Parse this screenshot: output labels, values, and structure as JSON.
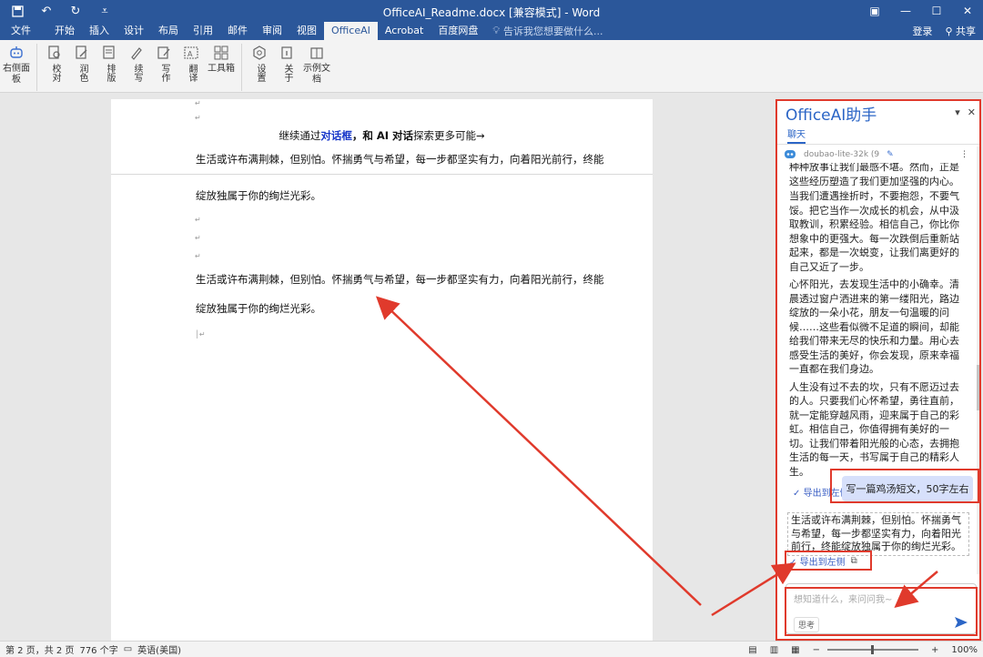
{
  "titlebar": {
    "title": "OfficeAI_Readme.docx [兼容模式] - Word"
  },
  "menu": {
    "tabs": [
      "文件",
      "开始",
      "插入",
      "设计",
      "布局",
      "引用",
      "邮件",
      "审阅",
      "视图",
      "OfficeAI",
      "Acrobat",
      "百度网盘"
    ],
    "active": "OfficeAI",
    "tell_me": "告诉我您想要做什么...",
    "login": "登录",
    "share": "共享"
  },
  "ribbon": {
    "buttons": [
      {
        "label": "右侧面板"
      },
      {
        "label": "校对"
      },
      {
        "label": "润色"
      },
      {
        "label": "排版"
      },
      {
        "label": "续写"
      },
      {
        "label": "写作"
      },
      {
        "label": "翻译"
      },
      {
        "label": "工具箱"
      },
      {
        "label": "设置"
      },
      {
        "label": "关于"
      },
      {
        "label": "示例文档"
      }
    ]
  },
  "document": {
    "line_center_pre": "继续通过",
    "line_center_link": "对话框",
    "line_center_bold": "，和 AI 对话",
    "line_center_post": "探索更多可能→",
    "para1_a": "生活或许布满荆棘，但别怕。怀揣勇气与希望，每一步都坚实有力，向着阳光前行，终能",
    "para1_b": "绽放独属于你的绚烂光彩。",
    "para2_a": "生活或许布满荆棘，但别怕。怀揣勇气与希望，每一步都坚实有力，向着阳光前行，终能",
    "para2_b": "绽放独属于你的绚烂光彩。"
  },
  "status": {
    "pages": "第 2 页，共 2 页",
    "words": "776 个字",
    "language": "英语(美国)",
    "zoom": "100%"
  },
  "pane": {
    "title": "OfficeAI助手",
    "tab": "聊天",
    "model": "doubao-lite-32k (9",
    "paragraphs": [
      "种种放事让我们最感不堪。然而，正是这些经历塑造了我们更加坚强的内心。",
      "当我们遭遇挫折时，不要抱怨，不要气馁。把它当作一次成长的机会，从中汲取教训，积累经验。相信自己，你比你想象中的更强大。每一次跌倒后重新站起来，都是一次蜕变，让我们离更好的自己又近了一步。",
      "心怀阳光，去发现生活中的小确幸。清晨透过窗户洒进来的第一缕阳光，路边绽放的一朵小花，朋友一句温暖的问候……这些看似微不足道的瞬间，却能给我们带来无尽的快乐和力量。用心去感受生活的美好，你会发现，原来幸福一直都在我们身边。",
      "人生没有过不去的坎，只有不愿迈过去的人。只要我们心怀希望，勇往直前，就一定能穿越风雨，迎来属于自己的彩虹。相信自己，你值得拥有美好的一切。让我们带着阳光般的心态，去拥抱生活的每一天，书写属于自己的精彩人生。"
    ],
    "export_label": "导出到左侧",
    "user_message": "写一篇鸡汤短文，50字左右",
    "answer": "生活或许布满荆棘，但别怕。怀揣勇气与希望，每一步都坚实有力，向着阳光前行，终能绽放独属于你的绚烂光彩。",
    "input_placeholder": "想知道什么，来问问我~",
    "think_label": "思考"
  },
  "colors": {
    "ribbon_blue": "#2b579a",
    "accent": "#2b65c6",
    "highlight": "#e03a2c"
  }
}
